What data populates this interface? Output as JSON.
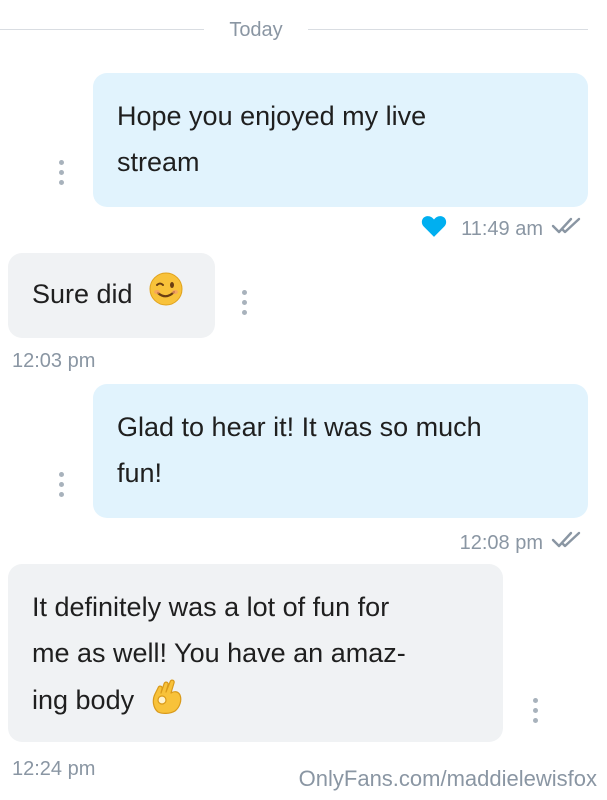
{
  "date_divider": {
    "label": "Today"
  },
  "messages": [
    {
      "direction": "outgoing",
      "lines": [
        "Hope you enjoyed my live",
        "stream"
      ],
      "time": "11:49 am",
      "liked": true,
      "read": true
    },
    {
      "direction": "incoming",
      "text": "Sure did",
      "emoji": "winking-face",
      "time": "12:03 pm"
    },
    {
      "direction": "outgoing",
      "lines": [
        "Glad to hear it! It was so much",
        "fun!"
      ],
      "time": "12:08 pm",
      "read": true
    },
    {
      "direction": "incoming",
      "lines": [
        "It definitely was a lot of fun for",
        "me as well! You have an amaz-",
        "ing body"
      ],
      "emoji": "ok-hand",
      "time": "12:24 pm"
    }
  ],
  "watermark": "OnlyFans.com/maddielewisfox",
  "colors": {
    "outgoing_bubble": "#e1f3fd",
    "incoming_bubble": "#f0f2f4",
    "meta_text": "#8a96a3",
    "heart": "#00aff0",
    "kebab": "#a8b2bc"
  }
}
